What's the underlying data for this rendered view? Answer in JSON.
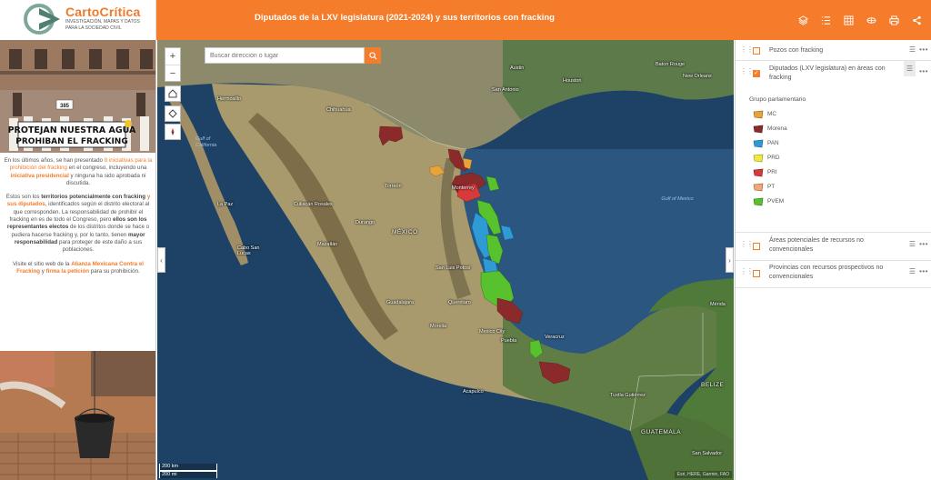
{
  "header": {
    "logo_name": "CartoCrítica",
    "logo_tagline_1": "INVESTIGACIÓN, MAPAS Y DATOS",
    "logo_tagline_2": "PARA LA SOCIEDAD CIVIL",
    "title": "Diputados de la LXV legislatura (2021-2024) y sus territorios con fracking",
    "toolbar": [
      {
        "icon": "layers-icon"
      },
      {
        "icon": "list-icon"
      },
      {
        "icon": "table-icon"
      },
      {
        "icon": "basemap-icon"
      },
      {
        "icon": "print-icon"
      },
      {
        "icon": "share-icon"
      }
    ]
  },
  "left_panel": {
    "photo_banner_1": "PROTEJAN NUESTRA AGUA",
    "photo_banner_2": "PROHIBAN EL FRACKING",
    "photo_sign": "385",
    "p1": {
      "t1": "En los últimos años, se han presentado ",
      "link1": "8 iniciativas para la prohibición del fracking",
      "t2": " en el congreso, incluyendo una ",
      "link2": "iniciativa presidencial",
      "t3": " y ninguna ha sido aprobada ni discutida."
    },
    "p2": {
      "t1": "Estos son los ",
      "b1": "territorios potencialmente con fracking",
      "t2": " ",
      "link1": "y sus diputados",
      "t3": ", identificados según el distrito electoral al que corresponden. La responsabilidad de prohibir el fracking en es de todo el Congreso, pero ",
      "b2": "ellos son los representantes electos",
      "t4": " de los distritos donde se hace o pudiera hacerse fracking y, por lo tanto, tienen ",
      "b3": "mayor responsabilidad",
      "t5": " para proteger de este daño a sus poblaciones."
    },
    "p3": {
      "t1": "Visite el sitio web de la ",
      "link1": "Alianza Mexicana Contra el Fracking",
      "t2": " y ",
      "link2": "firma la petición",
      "t3": " para su prohibición."
    }
  },
  "map": {
    "search_placeholder": "Buscar dirección o lugar",
    "zoom_in": "+",
    "zoom_out": "−",
    "scale_km": "200 km",
    "scale_mi": "200 mi",
    "attribution": "Esri, HERE, Garmin, FAO",
    "labels": {
      "austin": "Austin",
      "san_antonio": "San Antonio",
      "houston": "Houston",
      "baton_rouge": "Baton Rouge",
      "new_orleans": "New Orleans",
      "hermosillo": "Hermosillo",
      "chihuahua": "Chihuahua",
      "gulf_california": "Gulf of California",
      "monterrey": "Monterrey",
      "gulf_mexico": "Gulf of Mexico",
      "torreon": "Torreón",
      "la_paz": "La Paz",
      "culiacan": "Culiacán Rosales",
      "durango": "Durango",
      "mexico": "MÉXICO",
      "mazatlan": "Mazatlán",
      "cabo": "Cabo San Lucas",
      "san_luis": "San Luis Potosí",
      "guadalajara": "Guadalajara",
      "queretaro": "Querétaro",
      "morelia": "Morelia",
      "mexico_city": "Mexico City",
      "puebla": "Puebla",
      "veracruz": "Veracruz",
      "acapulco": "Acapulco",
      "merida": "Mérida",
      "belize": "BELIZE",
      "tuxtla": "Tuxtla Gutiérrez",
      "guatemala": "GUATEMALA",
      "san_salvador": "San Salvador"
    }
  },
  "layers": {
    "pozos": "Pozos con fracking",
    "diputados": "Diputados (LXV legislatura) en áreas con fracking",
    "areas": "Áreas potenciales de recursos no convencionales",
    "provincias": "Provincias con recursos prospectivos no convencionales",
    "legend_title": "Grupo parlamentario",
    "legend": [
      {
        "label": "MC",
        "color": "#e8a33b"
      },
      {
        "label": "Morena",
        "color": "#8b2a2a"
      },
      {
        "label": "PAN",
        "color": "#2e9bd6"
      },
      {
        "label": "PRD",
        "color": "#f2e93a"
      },
      {
        "label": "PRI",
        "color": "#d63a3a"
      },
      {
        "label": "PT",
        "color": "#f0a57a"
      },
      {
        "label": "PVEM",
        "color": "#58c22e"
      }
    ]
  },
  "chart_data": null
}
